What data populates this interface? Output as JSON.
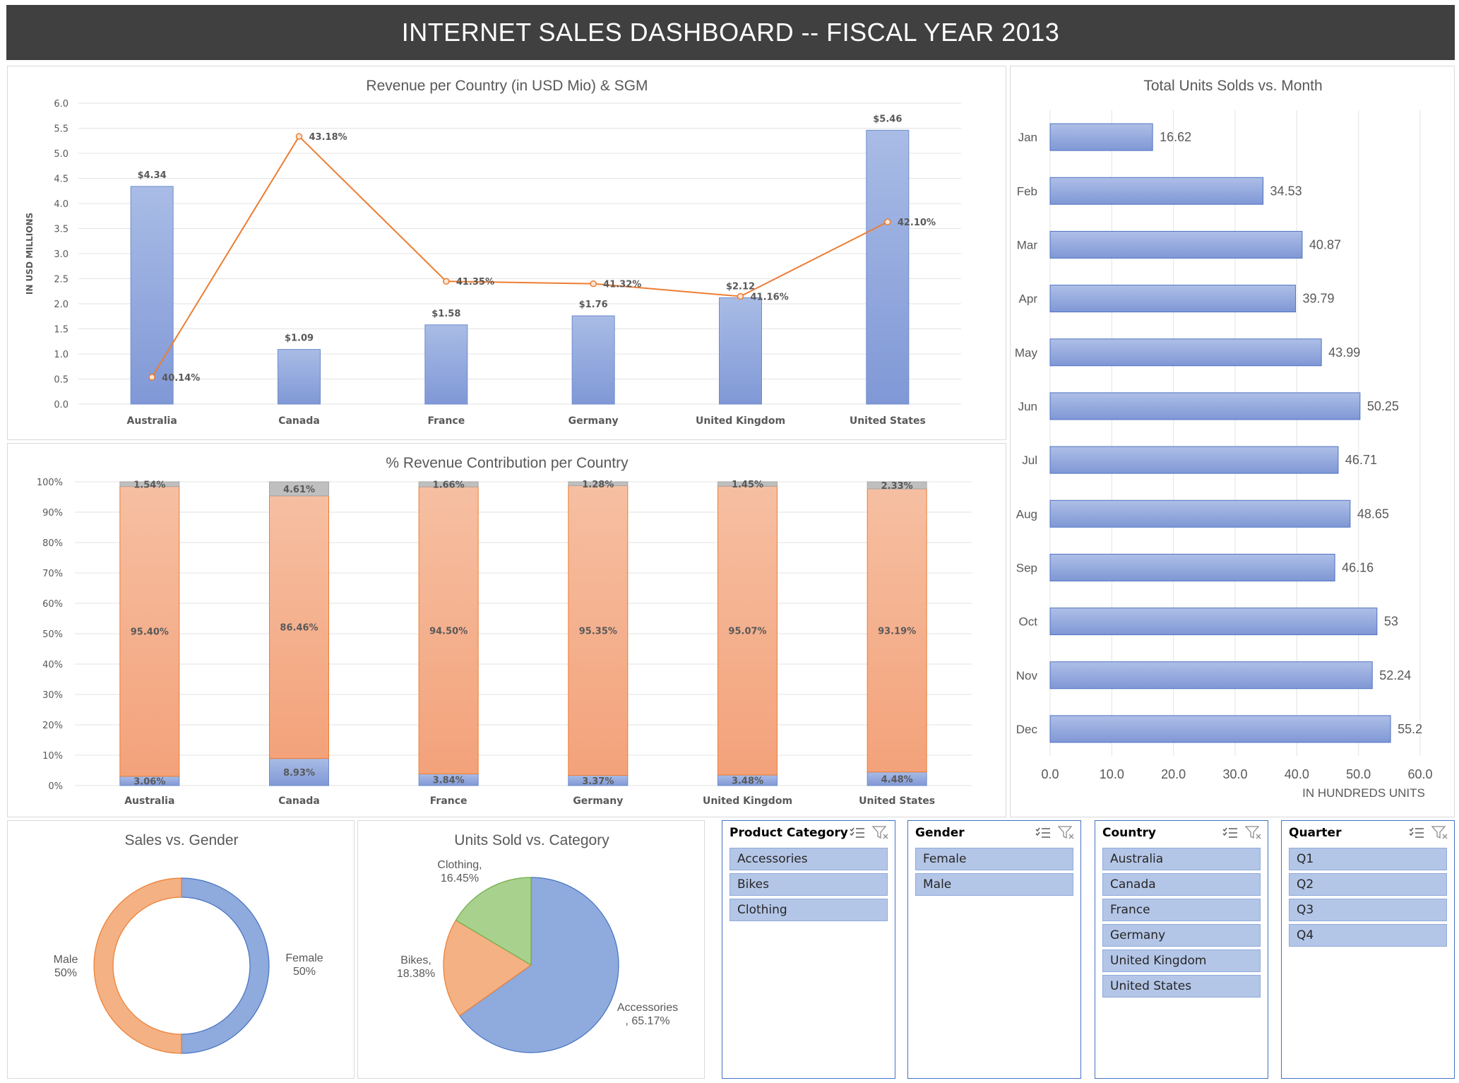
{
  "dashboard_title": "INTERNET SALES DASHBOARD -- FISCAL YEAR 2013",
  "colors": {
    "blue": "#8faadc",
    "orange": "#ed7d31",
    "peach": "#f4b183",
    "gray": "#bfbfbf",
    "green": "#a9d18e",
    "banner": "#404040"
  },
  "chart_data": [
    {
      "type": "bar",
      "title": "Revenue per Country (in USD Mio) & SGM",
      "ylabel": "IN USD MILLIONS",
      "ylim": [
        0,
        6
      ],
      "yticks": [
        "0.0",
        "0.5",
        "1.0",
        "1.5",
        "2.0",
        "2.5",
        "3.0",
        "3.5",
        "4.0",
        "4.5",
        "5.0",
        "5.5",
        "6.0"
      ],
      "categories": [
        "Australia",
        "Canada",
        "France",
        "Germany",
        "United Kingdom",
        "United States"
      ],
      "values": [
        4.34,
        1.09,
        1.58,
        1.76,
        2.12,
        5.46
      ],
      "value_labels": [
        "$4.34",
        "$1.09",
        "$1.58",
        "$1.76",
        "$2.12",
        "$5.46"
      ],
      "line_values": [
        40.14,
        43.18,
        41.35,
        41.32,
        41.16,
        42.1
      ],
      "line_labels": [
        "40.14%",
        "43.18%",
        "41.35%",
        "41.32%",
        "41.16%",
        "42.10%"
      ],
      "line_range": [
        39.8,
        43.6
      ],
      "grid": true
    },
    {
      "type": "bar",
      "stacked": true,
      "title": "% Revenue Contribution per Country",
      "yticks": [
        "0%",
        "10%",
        "20%",
        "30%",
        "40%",
        "50%",
        "60%",
        "70%",
        "80%",
        "90%",
        "100%"
      ],
      "categories": [
        "Australia",
        "Canada",
        "France",
        "Germany",
        "United Kingdom",
        "United States"
      ],
      "series": [
        {
          "values": [
            3.06,
            8.93,
            3.84,
            3.37,
            3.48,
            4.48
          ],
          "labels": [
            "3.06%",
            "8.93%",
            "3.84%",
            "3.37%",
            "3.48%",
            "4.48%"
          ]
        },
        {
          "values": [
            95.4,
            86.46,
            94.5,
            95.35,
            95.07,
            93.19
          ],
          "labels": [
            "95.40%",
            "86.46%",
            "94.50%",
            "95.35%",
            "95.07%",
            "93.19%"
          ]
        },
        {
          "values": [
            1.54,
            4.61,
            1.66,
            1.28,
            1.45,
            2.33
          ],
          "labels": [
            "1.54%",
            "4.61%",
            "1.66%",
            "1.28%",
            "1.45%",
            "2.33%"
          ]
        }
      ],
      "grid": true
    },
    {
      "type": "bar",
      "orientation": "horizontal",
      "title": "Total Units Solds vs. Month",
      "xlabel": "IN HUNDREDS UNITS",
      "xlim": [
        0,
        60
      ],
      "xticks": [
        "0.0",
        "10.0",
        "20.0",
        "30.0",
        "40.0",
        "50.0",
        "60.0"
      ],
      "categories": [
        "Jan",
        "Feb",
        "Mar",
        "Apr",
        "May",
        "Jun",
        "Jul",
        "Aug",
        "Sep",
        "Oct",
        "Nov",
        "Dec"
      ],
      "values": [
        16.62,
        34.53,
        40.87,
        39.79,
        43.99,
        50.25,
        46.71,
        48.65,
        46.16,
        53,
        52.24,
        55.2
      ],
      "value_labels": [
        "16.62",
        "34.53",
        "40.87",
        "39.79",
        "43.99",
        "50.25",
        "46.71",
        "48.65",
        "46.16",
        "53",
        "52.24",
        "55.2"
      ],
      "grid": true
    },
    {
      "type": "pie",
      "donut": true,
      "title": "Sales vs. Gender",
      "categories": [
        "Female",
        "Male"
      ],
      "values": [
        50,
        50
      ],
      "labels": [
        [
          "Female",
          "50%"
        ],
        [
          "Male",
          "50%"
        ]
      ]
    },
    {
      "type": "pie",
      "title": "Units Sold vs. Category",
      "categories": [
        "Accessories",
        "Bikes",
        "Clothing"
      ],
      "values": [
        65.17,
        18.38,
        16.45
      ],
      "labels": [
        [
          "Accessories",
          ", 65.17%"
        ],
        [
          "Bikes,",
          "18.38%"
        ],
        [
          "Clothing,",
          "16.45%"
        ]
      ]
    }
  ],
  "slicers": [
    {
      "title": "Product Category",
      "items": [
        "Accessories",
        "Bikes",
        "Clothing"
      ]
    },
    {
      "title": "Gender",
      "items": [
        "Female",
        "Male"
      ]
    },
    {
      "title": "Country",
      "items": [
        "Australia",
        "Canada",
        "France",
        "Germany",
        "United Kingdom",
        "United States"
      ]
    },
    {
      "title": "Quarter",
      "items": [
        "Q1",
        "Q2",
        "Q3",
        "Q4"
      ]
    }
  ]
}
